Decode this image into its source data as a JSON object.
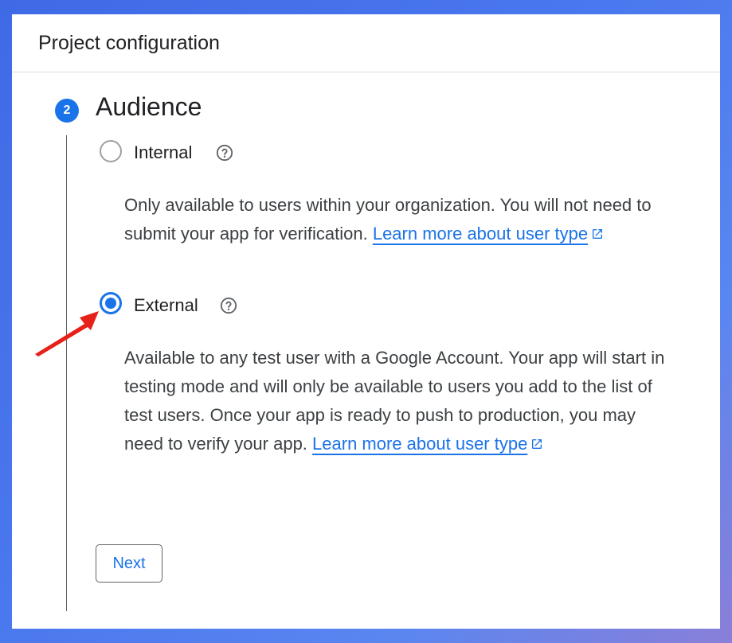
{
  "header": {
    "title": "Project configuration"
  },
  "step": {
    "number": "2",
    "title": "Audience"
  },
  "options": [
    {
      "label": "Internal",
      "selected": false,
      "description": "Only available to users within your organization. You will not need to submit your app for verification.",
      "link_text": "Learn more about user type"
    },
    {
      "label": "External",
      "selected": true,
      "description": "Available to any test user with a Google Account. Your app will start in testing mode and will only be available to users you add to the list of test users. Once your app is ready to push to production, you may need to verify your app.",
      "link_text": "Learn more about user type"
    }
  ],
  "next_label": "Next",
  "colors": {
    "accent": "#1a73e8",
    "annotation_arrow": "#e8201a",
    "background": "#4a78ee"
  },
  "icons": [
    "help-icon",
    "external-link-icon",
    "annotation-arrow"
  ]
}
